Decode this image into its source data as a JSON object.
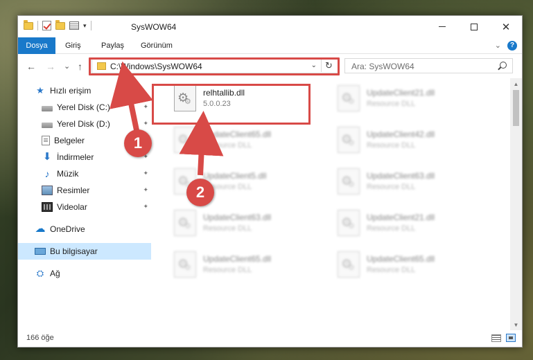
{
  "window": {
    "title": "SysWOW64",
    "minimize": "—",
    "close": "✕"
  },
  "ribbon": {
    "tabs": [
      "Dosya",
      "Giriş",
      "Paylaş",
      "Görünüm"
    ],
    "help": "?",
    "collapse": "⌄"
  },
  "nav": {
    "back": "←",
    "forward": "→",
    "recent": "⌄",
    "up": "↑",
    "address": "C:\\Windows\\SysWOW64",
    "address_dropdown": "⌄",
    "refresh": "↻",
    "search_placeholder": "Ara: SysWOW64"
  },
  "sidebar": {
    "items": [
      {
        "label": "Hızlı erişim",
        "icon": "star-icon"
      },
      {
        "label": "Yerel Disk (C:)",
        "icon": "disk-icon",
        "pinned": true
      },
      {
        "label": "Yerel Disk (D:)",
        "icon": "disk-icon",
        "pinned": true
      },
      {
        "label": "Belgeler",
        "icon": "documents-icon",
        "pinned": true
      },
      {
        "label": "İndirmeler",
        "icon": "download-icon",
        "pinned": true
      },
      {
        "label": "Müzik",
        "icon": "music-icon",
        "pinned": true
      },
      {
        "label": "Resimler",
        "icon": "pictures-icon",
        "pinned": true
      },
      {
        "label": "Videolar",
        "icon": "videos-icon",
        "pinned": true
      },
      {
        "label": "OneDrive",
        "icon": "onedrive-icon"
      },
      {
        "label": "Bu bilgisayar",
        "icon": "computer-icon",
        "selected": true
      },
      {
        "label": "Ağ",
        "icon": "network-icon"
      }
    ],
    "pin_glyph": "📌"
  },
  "files": [
    {
      "name": "relhtallib.dll",
      "sub": "5.0.0.23",
      "highlighted": true
    },
    {
      "name": "UpdateClient21.dll",
      "sub": "Resource DLL"
    },
    {
      "name": "UpdateClient65.dll",
      "sub": "Resource DLL"
    },
    {
      "name": "UpdateClient42.dll",
      "sub": "Resource DLL"
    },
    {
      "name": "UpdateClient5.dll",
      "sub": "Resource DLL"
    },
    {
      "name": "UpdateClient63.dll",
      "sub": "Resource DLL"
    },
    {
      "name": "UpdateClient63.dll",
      "sub": "Resource DLL"
    },
    {
      "name": "UpdateClient21.dll",
      "sub": "Resource DLL"
    },
    {
      "name": "UpdateClient65.dll",
      "sub": "Resource DLL"
    },
    {
      "name": "UpdateClient65.dll",
      "sub": "Resource DLL"
    }
  ],
  "status": {
    "count": "166 öğe"
  },
  "annotations": {
    "badge1": "1",
    "badge2": "2",
    "color": "#d84a47"
  },
  "colors": {
    "accent": "#1979ca",
    "selection": "#cce8ff",
    "highlight": "#d84a47"
  }
}
